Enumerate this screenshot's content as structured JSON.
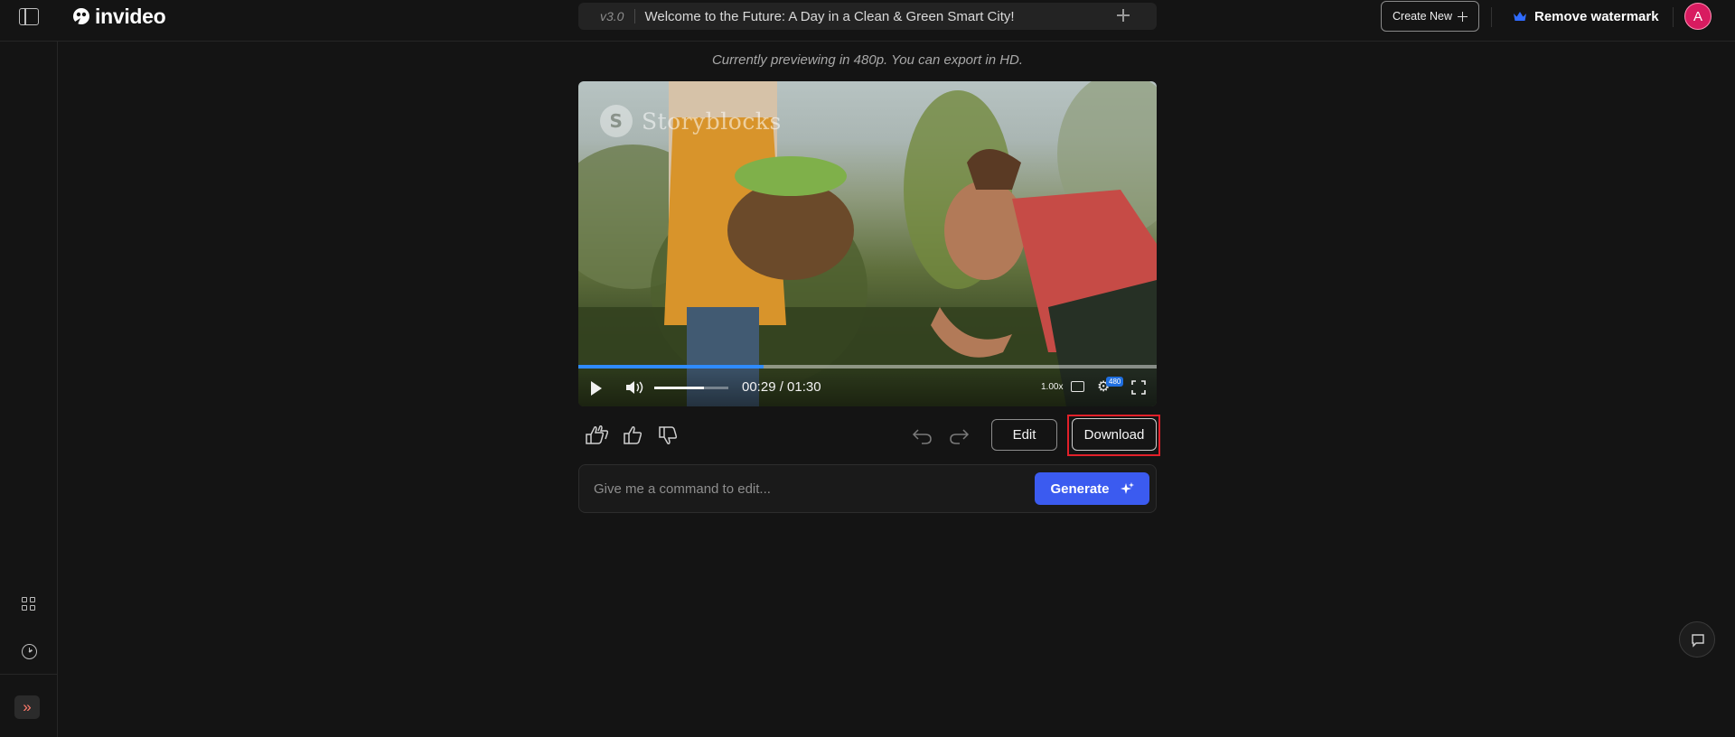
{
  "brand": {
    "name": "invideo"
  },
  "header": {
    "version": "v3.0",
    "project_title": "Welcome to the Future: A Day in a Clean & Green Smart City!",
    "create_new_label": "Create New",
    "remove_watermark_label": "Remove watermark",
    "avatar_initial": "A"
  },
  "main": {
    "preview_note": "Currently previewing in 480p. You can export in HD.",
    "video": {
      "watermark_text": "Storyblocks",
      "watermark_mark": "S",
      "time_label": "00:29 / 01:30",
      "current_time": "00:29",
      "duration": "01:30",
      "progress_fraction": 0.32,
      "volume_fraction": 0.67,
      "playback_rate": "1.00x",
      "quality_badge": "480"
    },
    "actions": {
      "edit_label": "Edit",
      "download_label": "Download"
    },
    "command": {
      "placeholder": "Give me a command to edit...",
      "generate_label": "Generate"
    }
  },
  "colors": {
    "background": "#141414",
    "accent": "#3b5bf0",
    "progress": "#2f8bff",
    "highlight": "#e2202a",
    "avatar": "#d81b60"
  },
  "icons": [
    "sidebar-toggle-icon",
    "plus-icon",
    "crown-icon",
    "grid-icon",
    "clock-icon",
    "expand-icon",
    "play-icon",
    "volume-icon",
    "loop-icon",
    "settings-icon",
    "fullscreen-icon",
    "love-icon",
    "thumbs-up-icon",
    "thumbs-down-icon",
    "undo-icon",
    "redo-icon",
    "sparkle-icon",
    "chat-icon"
  ]
}
